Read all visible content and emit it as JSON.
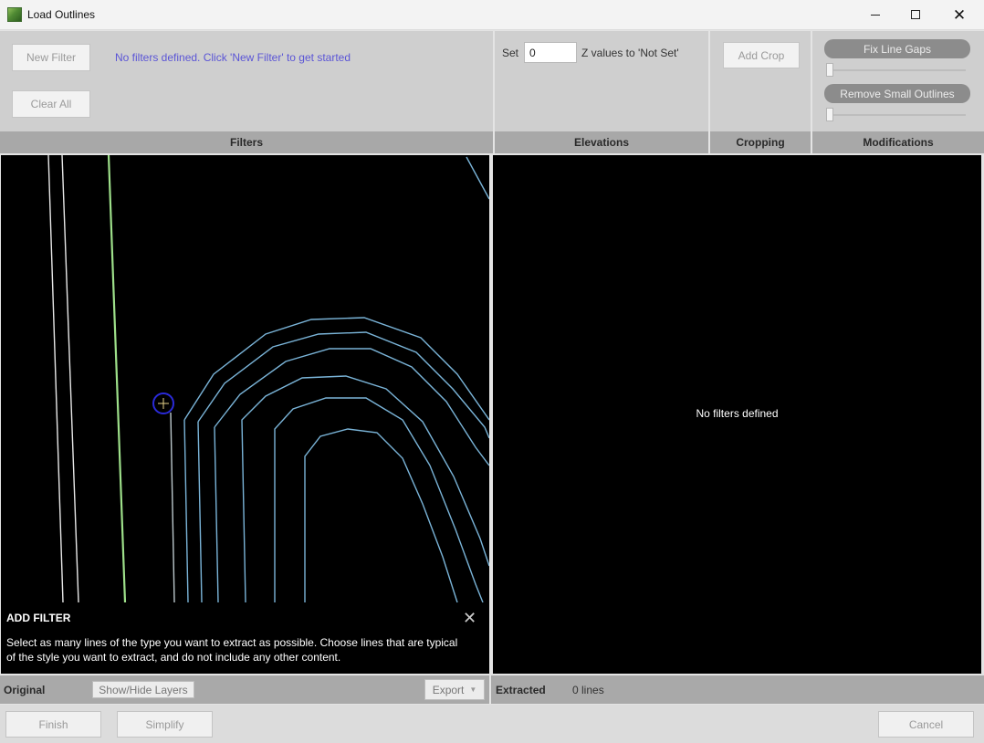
{
  "window": {
    "title": "Load Outlines"
  },
  "filters": {
    "new_filter_label": "New Filter",
    "clear_all_label": "Clear All",
    "hint": "No filters defined. Click 'New Filter' to get started",
    "section_label": "Filters"
  },
  "elevations": {
    "set_label": "Set",
    "z_value": "0",
    "suffix": "Z values to 'Not Set'",
    "section_label": "Elevations"
  },
  "cropping": {
    "add_crop_label": "Add Crop",
    "section_label": "Cropping"
  },
  "modifications": {
    "fix_line_gaps_label": "Fix Line Gaps",
    "fix_line_gaps_level": 0,
    "remove_small_outlines_label": "Remove Small Outlines",
    "remove_small_outlines_level": 0,
    "section_label": "Modifications"
  },
  "add_filter": {
    "title": "ADD FILTER",
    "body": "Select as many lines of the type you want to extract as possible.  Choose lines that are typical of the style you want to extract, and do not include any other content."
  },
  "extracted_view": {
    "empty_message": "No filters defined"
  },
  "status": {
    "original_label": "Original",
    "show_hide_layers_label": "Show/Hide Layers",
    "export_label": "Export",
    "extracted_label": "Extracted",
    "line_count": "0 lines"
  },
  "footer": {
    "finish_label": "Finish",
    "simplify_label": "Simplify",
    "cancel_label": "Cancel"
  },
  "colors": {
    "accent_hint": "#5b55d6",
    "contour_line": "#7ab4d8",
    "highlight_line": "#9ee08a",
    "white_line": "#e8e8e8",
    "cursor": "#2a2ad8"
  },
  "icons": [
    "app-icon",
    "minimize-icon",
    "maximize-icon",
    "close-icon",
    "chevron-down-icon",
    "close-overlay-icon",
    "crosshair-cursor-icon"
  ]
}
